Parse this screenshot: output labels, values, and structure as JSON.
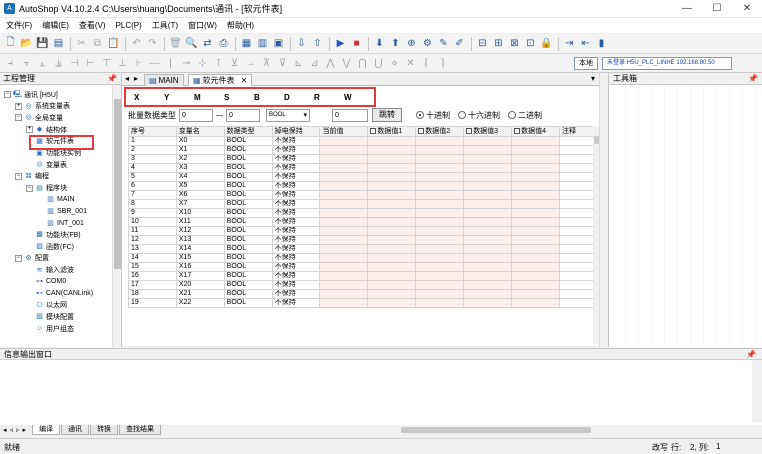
{
  "window": {
    "title": "AutoShop V4.10.2.4  C:\\Users\\huang\\Documents\\通讯 - [软元件表]",
    "controls": [
      "—",
      "☐",
      "✕"
    ]
  },
  "menu": [
    "文件(F)",
    "编辑(E)",
    "查看(V)",
    "PLC(P)",
    "工具(T)",
    "窗口(W)",
    "帮助(H)"
  ],
  "toolbar": {
    "row1_icons": [
      "new-file",
      "open-folder",
      "save",
      "save-all",
      "cut",
      "copy",
      "paste",
      "undo",
      "redo",
      "delete",
      "find",
      "replace",
      "compile",
      "download",
      "monitor",
      "monitor-write",
      "run",
      "stop",
      "upload",
      "write",
      "online",
      "settings",
      "comment",
      "ladder",
      "ladder-parallel",
      "network",
      "config",
      "print",
      "exit"
    ],
    "right_button": "本地",
    "connection_info": "未登录 H5U_PLC_LINHE 192.168.80.50"
  },
  "left_panel": {
    "title": "工程管理",
    "tree": [
      {
        "label": "通讯 [H5U]",
        "level": 0,
        "icon": "computer-icon",
        "expand": "−"
      },
      {
        "label": "系统变量表",
        "level": 1,
        "icon": "globe-icon",
        "expand": "+"
      },
      {
        "label": "全局变量",
        "level": 1,
        "icon": "globe-icon",
        "expand": "−"
      },
      {
        "label": "结构体",
        "level": 2,
        "icon": "struct-icon",
        "expand": "+"
      },
      {
        "label": "软元件表",
        "level": 2,
        "icon": "table-icon",
        "expand": ""
      },
      {
        "label": "功能块实例",
        "level": 2,
        "icon": "block-icon",
        "expand": ""
      },
      {
        "label": "变量表",
        "level": 2,
        "icon": "globe-icon",
        "expand": ""
      },
      {
        "label": "编程",
        "level": 1,
        "icon": "code-icon",
        "expand": "−"
      },
      {
        "label": "程序块",
        "level": 2,
        "icon": "folder-icon",
        "expand": "−"
      },
      {
        "label": "MAIN",
        "level": 3,
        "icon": "program-icon",
        "expand": ""
      },
      {
        "label": "SBR_001",
        "level": 3,
        "icon": "program-icon",
        "expand": ""
      },
      {
        "label": "INT_001",
        "level": 3,
        "icon": "program-icon",
        "expand": ""
      },
      {
        "label": "功能块(FB)",
        "level": 2,
        "icon": "fb-icon",
        "expand": ""
      },
      {
        "label": "函数(FC)",
        "level": 2,
        "icon": "fc-icon",
        "expand": ""
      },
      {
        "label": "配置",
        "level": 1,
        "icon": "config-icon",
        "expand": "−"
      },
      {
        "label": "输入滤波",
        "level": 2,
        "icon": "filter-icon",
        "expand": ""
      },
      {
        "label": "COM0",
        "level": 2,
        "icon": "port-icon",
        "expand": ""
      },
      {
        "label": "CAN(CANLink)",
        "level": 2,
        "icon": "can-icon",
        "expand": ""
      },
      {
        "label": "以太网",
        "level": 2,
        "icon": "ethernet-icon",
        "expand": ""
      },
      {
        "label": "模块配置",
        "level": 2,
        "icon": "module-icon",
        "expand": ""
      },
      {
        "label": "用户组态",
        "level": 2,
        "icon": "user-icon",
        "expand": ""
      }
    ]
  },
  "tabs": [
    {
      "label": "MAIN",
      "active": false
    },
    {
      "label": "软元件表",
      "active": true
    }
  ],
  "device_letters": [
    "X",
    "Y",
    "M",
    "S",
    "B",
    "D",
    "R",
    "W"
  ],
  "batch": {
    "label": "批量数据类型",
    "from": "0",
    "dash": "—",
    "to": "0",
    "type": "BOOL",
    "value": "0",
    "button": "跳转",
    "radios": [
      {
        "label": "十进制",
        "selected": true
      },
      {
        "label": "十六进制",
        "selected": false
      },
      {
        "label": "二进制",
        "selected": false
      }
    ]
  },
  "table": {
    "headers": [
      "序号",
      "变量名",
      "数据类型",
      "掉电保持",
      "当前值",
      "数据值1",
      "数据值2",
      "数据值3",
      "数据值4",
      "注释"
    ],
    "rows": [
      [
        "1",
        "X0",
        "BOOL",
        "不保持"
      ],
      [
        "2",
        "X1",
        "BOOL",
        "不保持"
      ],
      [
        "3",
        "X2",
        "BOOL",
        "不保持"
      ],
      [
        "4",
        "X3",
        "BOOL",
        "不保持"
      ],
      [
        "5",
        "X4",
        "BOOL",
        "不保持"
      ],
      [
        "6",
        "X5",
        "BOOL",
        "不保持"
      ],
      [
        "7",
        "X6",
        "BOOL",
        "不保持"
      ],
      [
        "8",
        "X7",
        "BOOL",
        "不保持"
      ],
      [
        "9",
        "X10",
        "BOOL",
        "不保持"
      ],
      [
        "10",
        "X11",
        "BOOL",
        "不保持"
      ],
      [
        "11",
        "X12",
        "BOOL",
        "不保持"
      ],
      [
        "12",
        "X13",
        "BOOL",
        "不保持"
      ],
      [
        "13",
        "X14",
        "BOOL",
        "不保持"
      ],
      [
        "14",
        "X15",
        "BOOL",
        "不保持"
      ],
      [
        "15",
        "X16",
        "BOOL",
        "不保持"
      ],
      [
        "16",
        "X17",
        "BOOL",
        "不保持"
      ],
      [
        "17",
        "X20",
        "BOOL",
        "不保持"
      ],
      [
        "18",
        "X21",
        "BOOL",
        "不保持"
      ],
      [
        "19",
        "X22",
        "BOOL",
        "不保持"
      ]
    ]
  },
  "right_panel": {
    "title": "工具箱"
  },
  "output": {
    "title": "信息输出窗口",
    "tabs": [
      "编译",
      "通讯",
      "转换",
      "查找结果"
    ]
  },
  "status": {
    "left": "就绪",
    "mode": "改写",
    "row_label": "行:",
    "row_col": "2, 列:",
    "col_value": "1"
  },
  "colors": {
    "highlight": "#e03c3c",
    "accent": "#2a5d9f",
    "value_cell": "#fdf0ec"
  }
}
